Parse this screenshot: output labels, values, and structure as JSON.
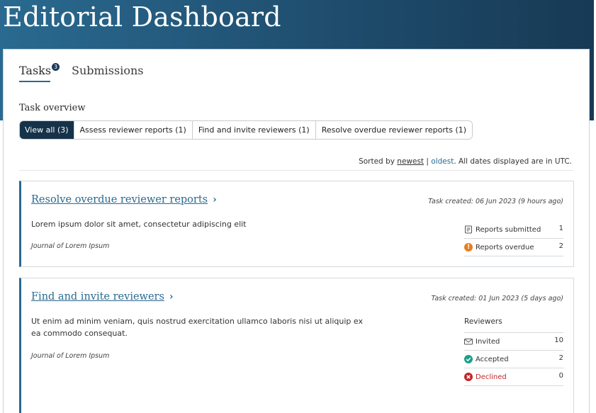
{
  "header": {
    "title": "Editorial Dashboard"
  },
  "tabs": [
    {
      "label": "Tasks",
      "badge": "3"
    },
    {
      "label": "Submissions"
    }
  ],
  "section": {
    "title": "Task overview"
  },
  "filters": [
    {
      "label": "View all (3)",
      "active": true
    },
    {
      "label": "Assess reviewer reports (1)"
    },
    {
      "label": "Find and invite reviewers (1)"
    },
    {
      "label": "Resolve overdue reviewer reports (1)"
    }
  ],
  "sort": {
    "prefix": "Sorted by",
    "newest": "newest",
    "separator": "|",
    "oldest": "oldest",
    "suffix": ". All dates displayed are in UTC."
  },
  "cards": [
    {
      "title": "Resolve overdue reviewer reports",
      "chevron": "›",
      "meta": "Task created: 06 Jun 2023 (9 hours ago)",
      "description": "Lorem ipsum dolor sit amet, consectetur adipiscing elit",
      "journal": "Journal of Lorem Ipsum",
      "stats": [
        {
          "icon": "reports-submitted-icon",
          "label": "Reports submitted",
          "value": "1"
        },
        {
          "icon": "warning-icon",
          "label": "Reports overdue",
          "value": "2"
        }
      ]
    },
    {
      "title": "Find and invite reviewers",
      "chevron": "›",
      "meta": "Task created: 01 Jun 2023 (5 days ago)",
      "description": "Ut enim ad minim veniam, quis nostrud exercitation ullamco laboris nisi ut aliquip ex ea commodo consequat.",
      "journal": "Journal of Lorem Ipsum",
      "stats_heading": "Reviewers",
      "stats": [
        {
          "icon": "envelope-icon",
          "label": "Invited",
          "value": "10"
        },
        {
          "icon": "check-circle-icon",
          "label": "Accepted",
          "value": "2"
        },
        {
          "icon": "x-circle-icon",
          "label": "Declined",
          "value": "0"
        }
      ]
    }
  ],
  "colors": {
    "brand": "#2a6a90",
    "active_filter": "#15324a",
    "warning": "#e67e22",
    "success": "#1e9e8a",
    "danger": "#c0282d"
  }
}
